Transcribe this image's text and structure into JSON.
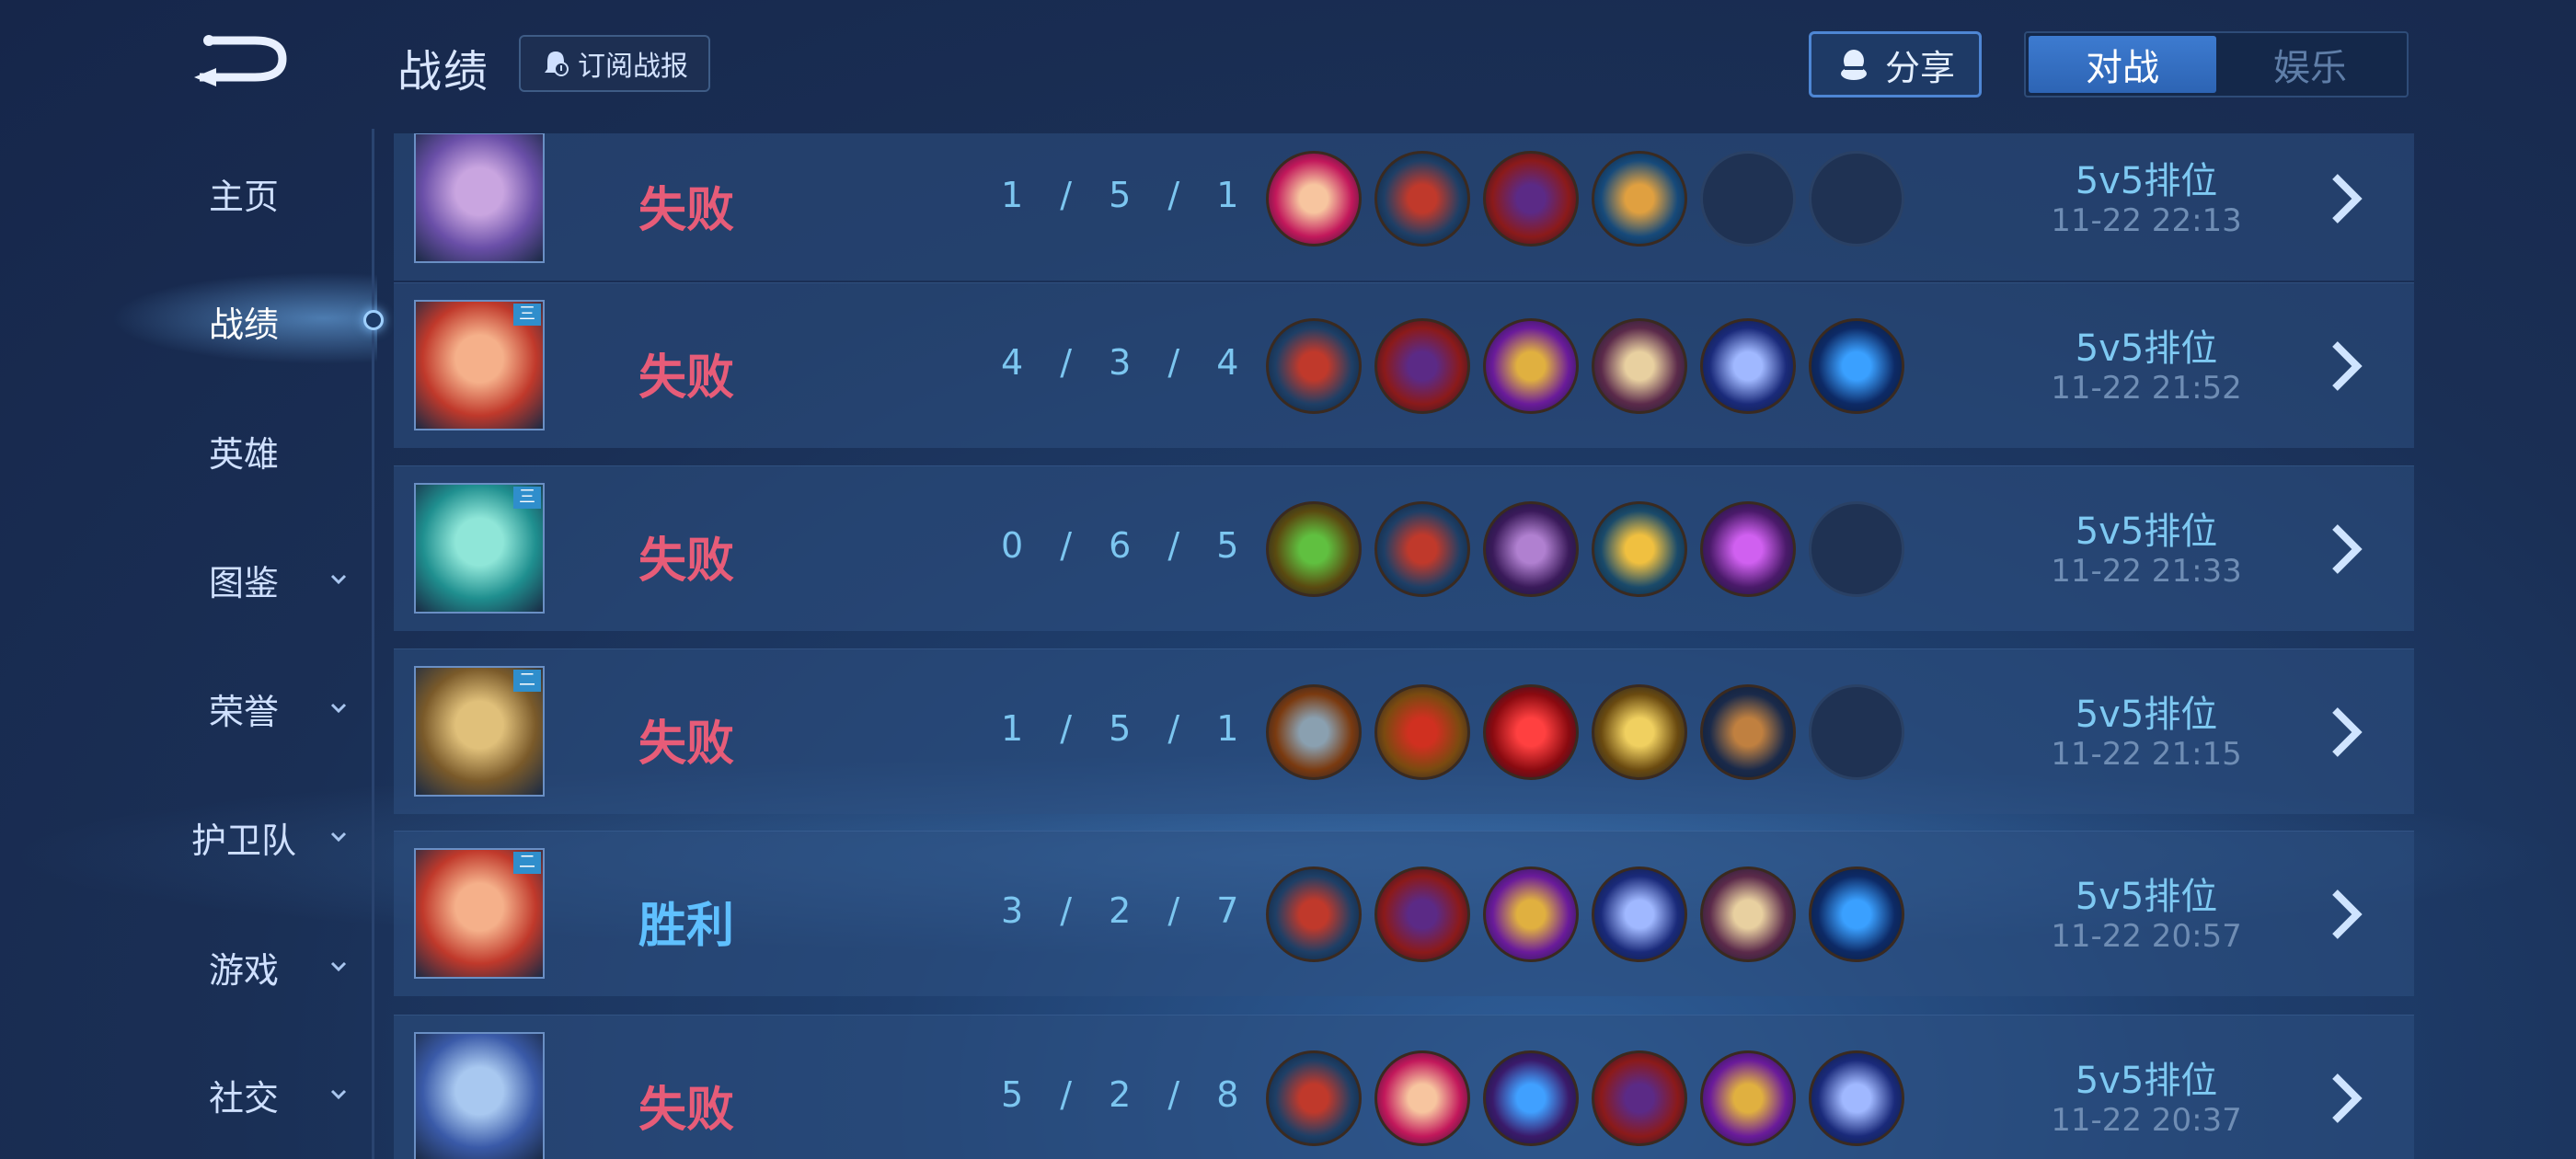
{
  "header": {
    "title": "战绩",
    "subscribe_label": "订阅战报",
    "share_label": "分享",
    "modes": [
      {
        "label": "对战",
        "active": true
      },
      {
        "label": "娱乐",
        "active": false
      }
    ]
  },
  "sidebar": {
    "items": [
      {
        "label": "主页",
        "has_arrow": false,
        "active": false
      },
      {
        "label": "战绩",
        "has_arrow": false,
        "active": true
      },
      {
        "label": "英雄",
        "has_arrow": false,
        "active": false
      },
      {
        "label": "图鉴",
        "has_arrow": true,
        "active": false
      },
      {
        "label": "荣誉",
        "has_arrow": true,
        "active": false
      },
      {
        "label": "护卫队",
        "has_arrow": true,
        "active": false
      },
      {
        "label": "游戏",
        "has_arrow": true,
        "active": false
      },
      {
        "label": "社交",
        "has_arrow": true,
        "active": false
      }
    ]
  },
  "colors": {
    "lose": "#e75c78",
    "win": "#5fc0ff",
    "accent": "#3d7bd0"
  },
  "matches": [
    {
      "hero_icon": "hero-portrait-purple-hair",
      "tier": "",
      "result": "失败",
      "outcome": "lose",
      "kda": "1 / 5 / 1",
      "items": [
        "book-icon",
        "boots-icon",
        "wizard-hat-icon",
        "orb-staff-icon",
        "empty",
        "empty"
      ],
      "mode": "5v5排位",
      "time": "11-22  22:13"
    },
    {
      "hero_icon": "hero-portrait-red-hair-glasses",
      "tier": "三",
      "result": "失败",
      "outcome": "lose",
      "kda": "4 / 3 / 4",
      "items": [
        "boots-icon",
        "wizard-hat-icon",
        "golden-mask-icon",
        "tome-icon",
        "scepter-icon",
        "blue-orb-icon"
      ],
      "mode": "5v5排位",
      "time": "11-22  21:52"
    },
    {
      "hero_icon": "hero-portrait-teal-hair",
      "tier": "三",
      "result": "失败",
      "outcome": "lose",
      "kda": "0 / 6 / 5",
      "items": [
        "green-amulet-icon",
        "boots-icon",
        "purple-book-icon",
        "gold-orb-icon",
        "purple-rune-icon",
        "empty"
      ],
      "mode": "5v5排位",
      "time": "11-22  21:33"
    },
    {
      "hero_icon": "hero-portrait-golden-crown",
      "tier": "二",
      "result": "失败",
      "outcome": "lose",
      "kda": "1 / 5 / 1",
      "items": [
        "iron-boots-icon",
        "red-blade-icon",
        "red-demon-icon",
        "golden-sword-icon",
        "gauntlet-icon",
        "empty"
      ],
      "mode": "5v5排位",
      "time": "11-22  21:15"
    },
    {
      "hero_icon": "hero-portrait-red-hair-glasses",
      "tier": "二",
      "result": "胜利",
      "outcome": "win",
      "kda": "3 / 2 / 7",
      "items": [
        "boots-icon",
        "wizard-hat-icon",
        "golden-mask-icon",
        "scepter-icon",
        "tome-icon",
        "blue-orb-icon"
      ],
      "mode": "5v5排位",
      "time": "11-22  20:57"
    },
    {
      "hero_icon": "hero-portrait-blue-armor",
      "tier": "",
      "result": "失败",
      "outcome": "lose",
      "kda": "5 / 2 / 8",
      "items": [
        "boots-icon",
        "book-icon",
        "blue-dragon-icon",
        "wizard-hat-icon",
        "golden-mask-icon",
        "scepter-icon"
      ],
      "mode": "5v5排位",
      "time": "11-22  20:37"
    }
  ]
}
